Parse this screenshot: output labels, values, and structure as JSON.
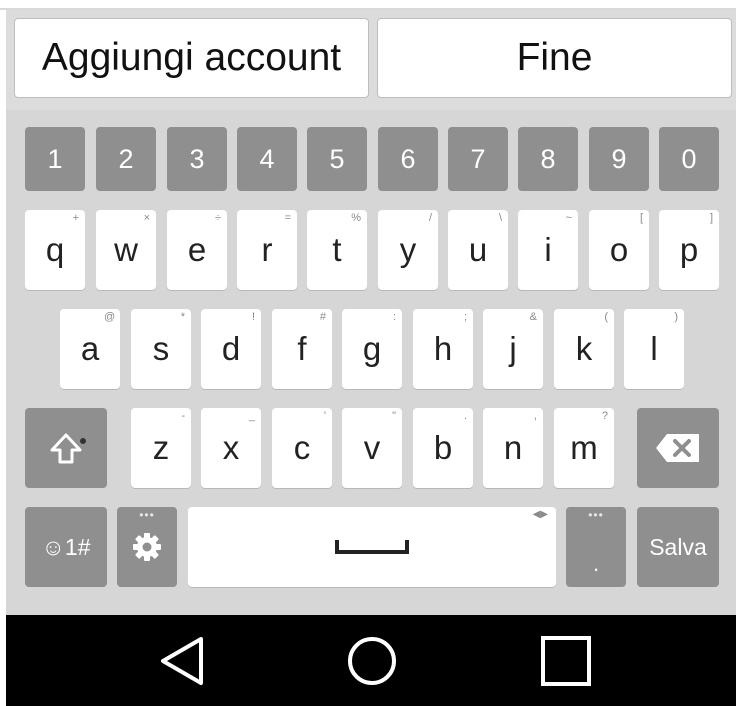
{
  "action_bar": {
    "add_account_label": "Aggiungi account",
    "done_label": "Fine"
  },
  "keyboard": {
    "number_row": [
      "1",
      "2",
      "3",
      "4",
      "5",
      "6",
      "7",
      "8",
      "9",
      "0"
    ],
    "row1": [
      {
        "key": "q",
        "hint": "+"
      },
      {
        "key": "w",
        "hint": "×"
      },
      {
        "key": "e",
        "hint": "÷"
      },
      {
        "key": "r",
        "hint": "="
      },
      {
        "key": "t",
        "hint": "%"
      },
      {
        "key": "y",
        "hint": "/"
      },
      {
        "key": "u",
        "hint": "\\"
      },
      {
        "key": "i",
        "hint": "~"
      },
      {
        "key": "o",
        "hint": "["
      },
      {
        "key": "p",
        "hint": "]"
      }
    ],
    "row2": [
      {
        "key": "a",
        "hint": "@"
      },
      {
        "key": "s",
        "hint": "*"
      },
      {
        "key": "d",
        "hint": "!"
      },
      {
        "key": "f",
        "hint": "#"
      },
      {
        "key": "g",
        "hint": ":"
      },
      {
        "key": "h",
        "hint": ";"
      },
      {
        "key": "j",
        "hint": "&"
      },
      {
        "key": "k",
        "hint": "("
      },
      {
        "key": "l",
        "hint": ")"
      }
    ],
    "row3": [
      {
        "key": "z",
        "hint": "-"
      },
      {
        "key": "x",
        "hint": "_"
      },
      {
        "key": "c",
        "hint": "'"
      },
      {
        "key": "v",
        "hint": "\""
      },
      {
        "key": "b",
        "hint": "."
      },
      {
        "key": "n",
        "hint": ","
      },
      {
        "key": "m",
        "hint": "?"
      }
    ],
    "symbols_label": "☺1#",
    "period_label": ".",
    "save_label": "Salva",
    "shift_icon": "shift-icon",
    "backspace_icon": "backspace-icon",
    "settings_icon": "gear-icon",
    "space_icon": "space-bar-icon"
  },
  "navbar": {
    "back_icon": "back-triangle-icon",
    "home_icon": "home-circle-icon",
    "recents_icon": "recents-square-icon"
  },
  "colors": {
    "keyboard_bg": "#d6d6d6",
    "dark_key": "#8f8f8f",
    "light_key": "#ffffff",
    "navbar_bg": "#000000"
  }
}
